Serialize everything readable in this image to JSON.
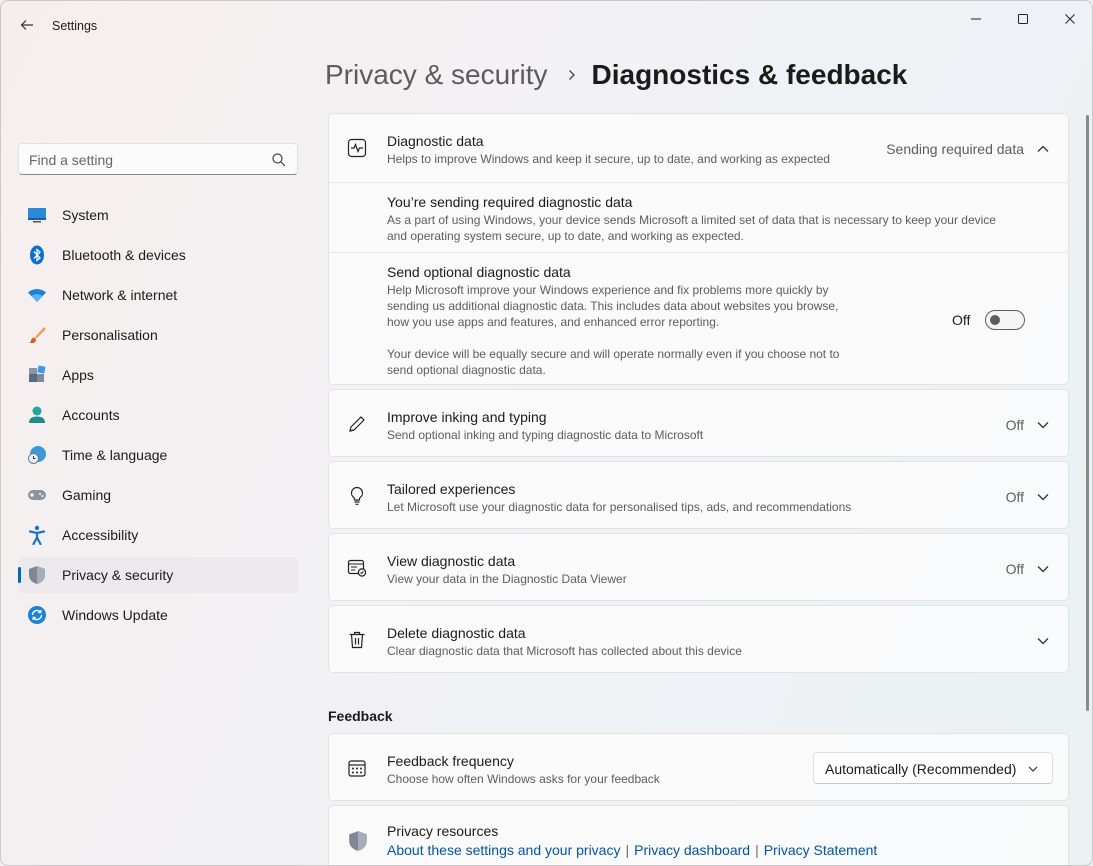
{
  "window": {
    "title": "Settings",
    "back_icon": "arrow-left-icon",
    "minimize_icon": "minimize-icon",
    "maximize_icon": "maximize-icon",
    "close_icon": "close-icon"
  },
  "search": {
    "placeholder": "Find a setting",
    "value": "",
    "icon": "search-icon"
  },
  "sidebar": {
    "items": [
      {
        "label": "System",
        "icon": "system-monitor-icon"
      },
      {
        "label": "Bluetooth & devices",
        "icon": "bluetooth-icon"
      },
      {
        "label": "Network & internet",
        "icon": "wifi-icon"
      },
      {
        "label": "Personalisation",
        "icon": "paintbrush-icon"
      },
      {
        "label": "Apps",
        "icon": "apps-icon"
      },
      {
        "label": "Accounts",
        "icon": "person-icon"
      },
      {
        "label": "Time & language",
        "icon": "globe-clock-icon"
      },
      {
        "label": "Gaming",
        "icon": "gamepad-icon"
      },
      {
        "label": "Accessibility",
        "icon": "accessibility-icon"
      },
      {
        "label": "Privacy & security",
        "icon": "shield-icon",
        "active": true
      },
      {
        "label": "Windows Update",
        "icon": "update-icon"
      }
    ]
  },
  "header": {
    "parent": "Privacy & security",
    "current": "Diagnostics & feedback"
  },
  "diagnostic_data": {
    "title": "Diagnostic data",
    "description": "Helps to improve Windows and keep it secure, up to date, and working as expected",
    "status": "Sending required data",
    "icon": "pulse-icon",
    "required": {
      "title": "You’re sending required diagnostic data",
      "description_line1": "As a part of using Windows, your device sends Microsoft a limited set of data that is necessary to keep your device",
      "description_line2": "and operating system secure, up to date, and working as expected."
    },
    "optional": {
      "title": "Send optional diagnostic data",
      "description_line1": "Help Microsoft improve your Windows experience and fix problems more quickly by",
      "description_line2": "sending us additional diagnostic data. This includes data about websites you browse,",
      "description_line3": "how you use apps and features, and enhanced error reporting.",
      "note_line1": "Your device will be equally secure and will operate normally even if you choose not to",
      "note_line2": "send optional diagnostic data.",
      "toggle_label": "Off",
      "toggle_on": false
    }
  },
  "inking": {
    "title": "Improve inking and typing",
    "description": "Send optional inking and typing diagnostic data to Microsoft",
    "status": "Off",
    "icon": "pen-icon"
  },
  "tailored": {
    "title": "Tailored experiences",
    "description": "Let Microsoft use your diagnostic data for personalised tips, ads, and recommendations",
    "status": "Off",
    "icon": "lightbulb-icon"
  },
  "view_data": {
    "title": "View diagnostic data",
    "description": "View your data in the Diagnostic Data Viewer",
    "status": "Off",
    "icon": "data-viewer-icon"
  },
  "delete_data": {
    "title": "Delete diagnostic data",
    "description": "Clear diagnostic data that Microsoft has collected about this device",
    "icon": "trash-icon"
  },
  "feedback": {
    "section_title": "Feedback",
    "frequency": {
      "title": "Feedback frequency",
      "description": "Choose how often Windows asks for your feedback",
      "selected": "Automatically (Recommended)",
      "icon": "calendar-icon"
    }
  },
  "privacy_resources": {
    "title": "Privacy resources",
    "icon": "shield-icon",
    "links": [
      "About these settings and your privacy",
      "Privacy dashboard",
      "Privacy Statement"
    ],
    "separator": "|"
  },
  "colors": {
    "accent": "#0067c0",
    "link": "#0055a6"
  }
}
